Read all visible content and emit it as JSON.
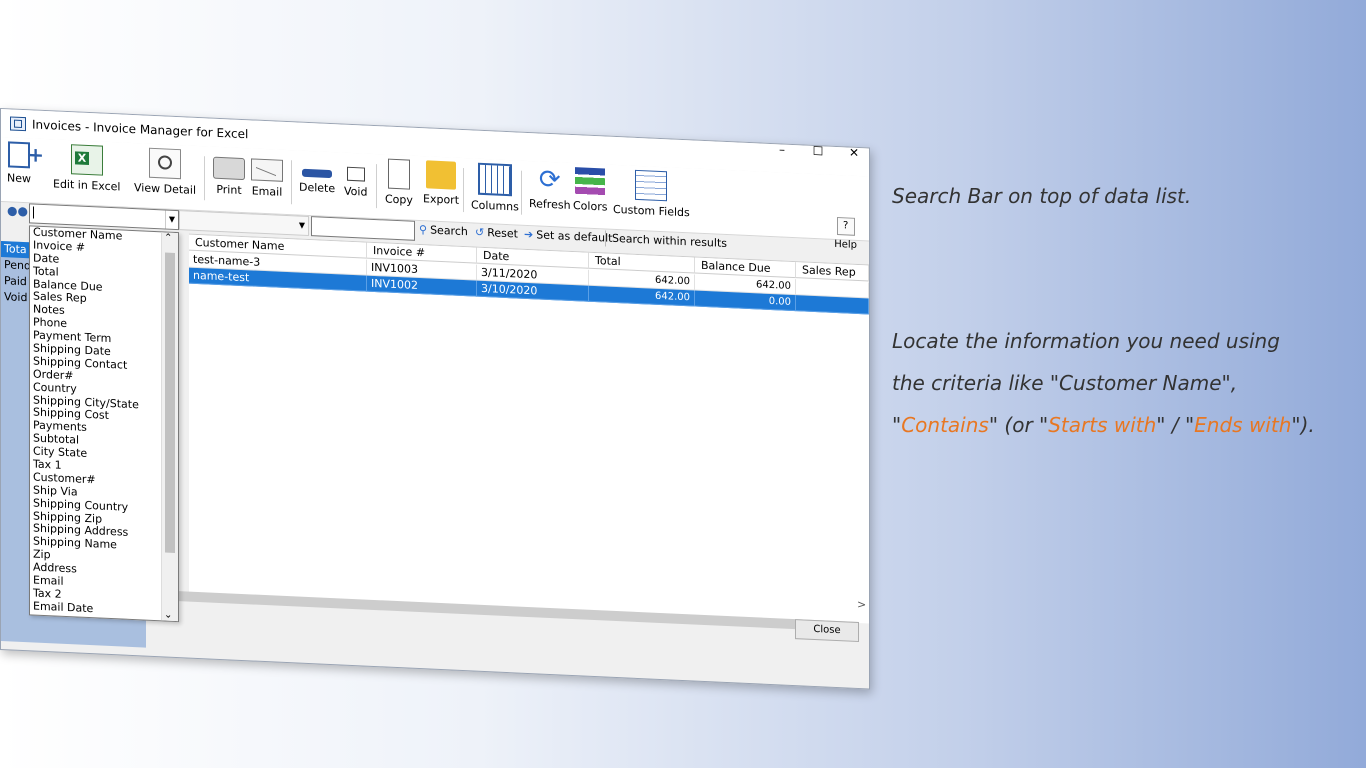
{
  "window": {
    "title": "Invoices - Invoice Manager for Excel",
    "controls": {
      "minimize": "–",
      "maximize": "☐",
      "close": "✕"
    }
  },
  "toolbar": {
    "new": "New",
    "edit_excel": "Edit in Excel",
    "view_detail": "View Detail",
    "print": "Print",
    "email": "Email",
    "delete": "Delete",
    "void": "Void",
    "copy": "Copy",
    "export": "Export",
    "columns": "Columns",
    "refresh": "Refresh",
    "colors": "Colors",
    "custom_fields": "Custom Fields",
    "help_symbol": "?",
    "help": "Help"
  },
  "search": {
    "field_value": "",
    "operator_value": "",
    "text_value": "",
    "search_label": "Search",
    "reset_label": "Reset",
    "set_default_label": "Set as default",
    "within_results_label": "Search within results"
  },
  "field_options": [
    "Customer Name",
    "Invoice #",
    "Date",
    "Total",
    "Balance Due",
    "Sales Rep",
    "Notes",
    "Phone",
    "Payment Term",
    "Shipping Date",
    "Shipping Contact",
    "Order#",
    "Country",
    "Shipping City/State",
    "Shipping Cost",
    "Payments",
    "Subtotal",
    "City State",
    "Tax 1",
    "Customer#",
    "Ship Via",
    "Shipping Country",
    "Shipping Zip",
    "Shipping Address",
    "Shipping Name",
    "Zip",
    "Address",
    "Email",
    "Tax 2",
    "Email Date"
  ],
  "left_panel": {
    "items": [
      "Tota",
      "Pend",
      "Paid",
      "Void"
    ]
  },
  "grid": {
    "columns": [
      "Customer Name",
      "Invoice #",
      "Date",
      "Total",
      "Balance Due",
      "Sales Rep"
    ],
    "rows": [
      {
        "customer": "test-name-3",
        "invoice": "INV1003",
        "date": "3/11/2020",
        "total": "642.00",
        "balance": "642.00",
        "rep": ""
      },
      {
        "customer": "name-test",
        "invoice": "INV1002",
        "date": "3/10/2020",
        "total": "642.00",
        "balance": "0.00",
        "rep": ""
      }
    ],
    "selected_row": 1
  },
  "footer": {
    "close": "Close",
    "scroll_left": "<",
    "scroll_right": ">"
  },
  "annotation": {
    "line1": "Search Bar on top of data list.",
    "line2": "Locate the information you need using",
    "line3": "the criteria like \"Customer Name\",",
    "q1": "\"",
    "contains": "Contains",
    "mid1": "\" (or \"",
    "starts": "Starts with",
    "mid2": "\" / \"",
    "ends": "Ends with",
    "tail": "\")."
  },
  "colors": {
    "selection": "#1d79d6",
    "highlight": "#e87722",
    "sidebar": "#a9bfdf"
  }
}
